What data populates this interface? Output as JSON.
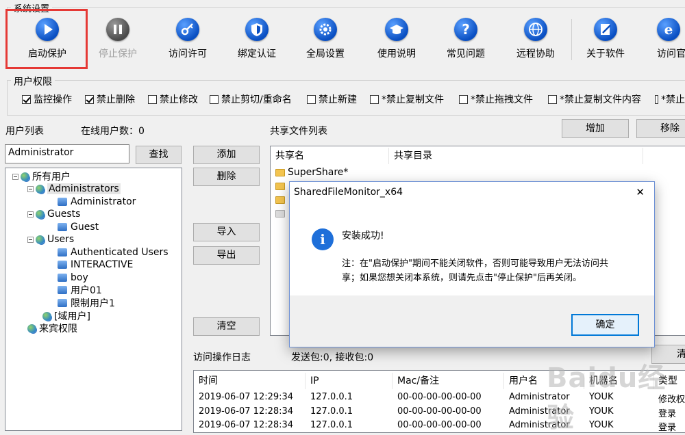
{
  "toolbar": {
    "group_title": "系统设置",
    "buttons": [
      {
        "label": "启动保护",
        "icon": "play-icon"
      },
      {
        "label": "停止保护",
        "icon": "pause-icon"
      },
      {
        "label": "访问许可",
        "icon": "key-icon"
      },
      {
        "label": "绑定认证",
        "icon": "shield-icon"
      },
      {
        "label": "全局设置",
        "icon": "gear-icon"
      },
      {
        "label": "使用说明",
        "icon": "graduation-cap-icon"
      },
      {
        "label": "常见问题",
        "icon": "question-icon"
      },
      {
        "label": "远程协助",
        "icon": "globe-icon"
      },
      {
        "label": "关于软件",
        "icon": "pen-icon"
      },
      {
        "label": "访问官",
        "icon": "ie-icon"
      }
    ]
  },
  "permissions": {
    "title": "用户权限",
    "items": [
      {
        "label": "监控操作",
        "checked": true
      },
      {
        "label": "禁止删除",
        "checked": true
      },
      {
        "label": "禁止修改",
        "checked": false
      },
      {
        "label": "禁止剪切/重命名",
        "checked": false
      },
      {
        "label": "禁止新建",
        "checked": false
      },
      {
        "label": "*禁止复制文件",
        "checked": false
      },
      {
        "label": "*禁止拖拽文件",
        "checked": false
      },
      {
        "label": "*禁止复制文件内容",
        "checked": false
      },
      {
        "label": "*禁止",
        "checked": false
      }
    ]
  },
  "users": {
    "list_label": "用户列表",
    "online_label": "在线用户数：0",
    "search_value": "Administrator",
    "find_button": "查找",
    "tree": [
      {
        "label": "所有用户",
        "type": "group"
      },
      {
        "label": "Administrators",
        "type": "group"
      },
      {
        "label": "Administrator",
        "type": "user"
      },
      {
        "label": "Guests",
        "type": "group"
      },
      {
        "label": "Guest",
        "type": "user"
      },
      {
        "label": "Users",
        "type": "group"
      },
      {
        "label": "Authenticated Users",
        "type": "user"
      },
      {
        "label": "INTERACTIVE",
        "type": "user"
      },
      {
        "label": "boy",
        "type": "user"
      },
      {
        "label": "用户01",
        "type": "user"
      },
      {
        "label": "限制用户1",
        "type": "user"
      },
      {
        "label": "[域用户]",
        "type": "group"
      },
      {
        "label": "来宾权限",
        "type": "group"
      }
    ]
  },
  "middle_buttons": {
    "add": "添加",
    "delete": "删除",
    "import": "导入",
    "export": "导出",
    "clear": "清空"
  },
  "shares": {
    "title": "共享文件列表",
    "add_button": "增加",
    "remove_button": "移除",
    "columns": [
      "共享名",
      "共享目录"
    ],
    "rows": [
      "SuperShare*"
    ]
  },
  "log": {
    "title": "访问操作日志",
    "stats": "发送包:0, 接收包:0",
    "clear_button": "清",
    "columns": [
      "时间",
      "IP",
      "Mac/备注",
      "用户名",
      "机器名",
      "类型"
    ],
    "rows": [
      [
        "2019-06-07 12:29:34",
        "127.0.0.1",
        "00-00-00-00-00-00",
        "Administrator",
        "YOUK",
        "修改权"
      ],
      [
        "2019-06-07 12:28:34",
        "127.0.0.1",
        "00-00-00-00-00-00",
        "Administrator",
        "YOUK",
        "登录"
      ],
      [
        "2019-06-07 12:28:34",
        "127.0.0.1",
        "00-00-00-00-00-00",
        "Administrator",
        "YOUK",
        "登录"
      ]
    ]
  },
  "dialog": {
    "title": "SharedFileMonitor_x64",
    "heading": "安装成功!",
    "message_line1": "注：在\"启动保护\"期间不能关闭软件，否则可能导致用户无法访问共",
    "message_line2": "享；如果您想关闭本系统，则请先点击\"停止保护\"后再关闭。",
    "ok_button": "确定",
    "close_symbol": "✕"
  },
  "watermark": "Baidu经验",
  "colors": {
    "highlight": "#e53935",
    "icon_blue": "#0a4fc2",
    "dialog_border": "#6b8fd4"
  }
}
